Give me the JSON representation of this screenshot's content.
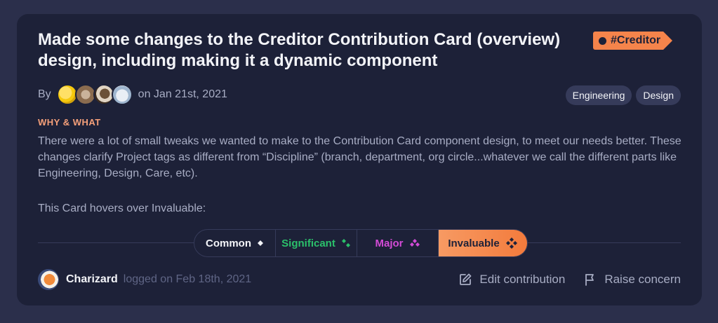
{
  "card": {
    "title": "Made some changes to the Creditor Contribution Card (overview) design, including making it a dynamic component",
    "project_tag": "#Creditor",
    "by_label": "By",
    "date": "on Jan 21st, 2021",
    "categories": [
      "Engineering",
      "Design"
    ],
    "section_label": "WHY & WHAT",
    "description": "There were a lot of small tweaks we wanted to make to the Contribution Card component design, to meet our needs better. These changes clarify Project tags as different from “Discipline” (branch, department, org circle...whatever we call the different parts like Engineering, Design, Care, etc).",
    "hover_text": "This Card hovers over Invaluable:",
    "tiers": [
      {
        "label": "Common",
        "color": "#f3f4f8"
      },
      {
        "label": "Significant",
        "color": "#2bc06b"
      },
      {
        "label": "Major",
        "color": "#d24bd6"
      },
      {
        "label": "Invaluable",
        "color": "#1d2138"
      }
    ],
    "active_tier": "Invaluable"
  },
  "footer": {
    "name": "Charizard",
    "logged": "logged on Feb 18th, 2021",
    "edit_label": "Edit contribution",
    "raise_label": "Raise concern"
  },
  "colors": {
    "accent": "#f5844b",
    "background": "#2b2f4b",
    "card": "#1d2138"
  }
}
